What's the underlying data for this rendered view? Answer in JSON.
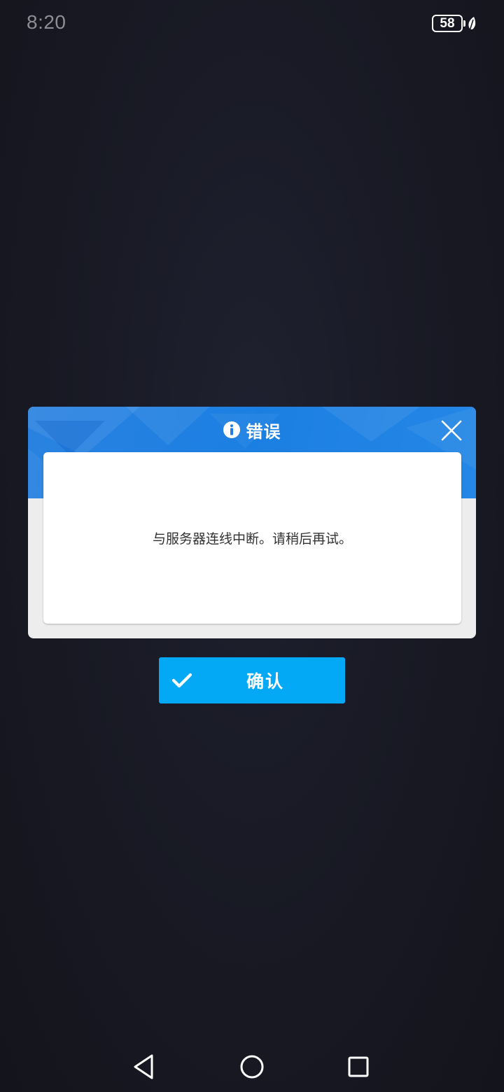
{
  "status_bar": {
    "time": "8:20",
    "battery_level": "58",
    "battery_icon": "battery-icon",
    "eco_icon": "leaf-icon"
  },
  "dialog": {
    "title": "错误",
    "title_icon": "info-icon",
    "close_icon": "close-icon",
    "message": "与服务器连线中断。请稍后再试。",
    "header_color": "#1b7fe2"
  },
  "confirm_button": {
    "label": "确认",
    "icon": "check-icon",
    "color": "#03a9f4"
  },
  "nav_bar": {
    "back_icon": "back-triangle-icon",
    "home_icon": "home-circle-icon",
    "recent_icon": "recent-square-icon"
  }
}
